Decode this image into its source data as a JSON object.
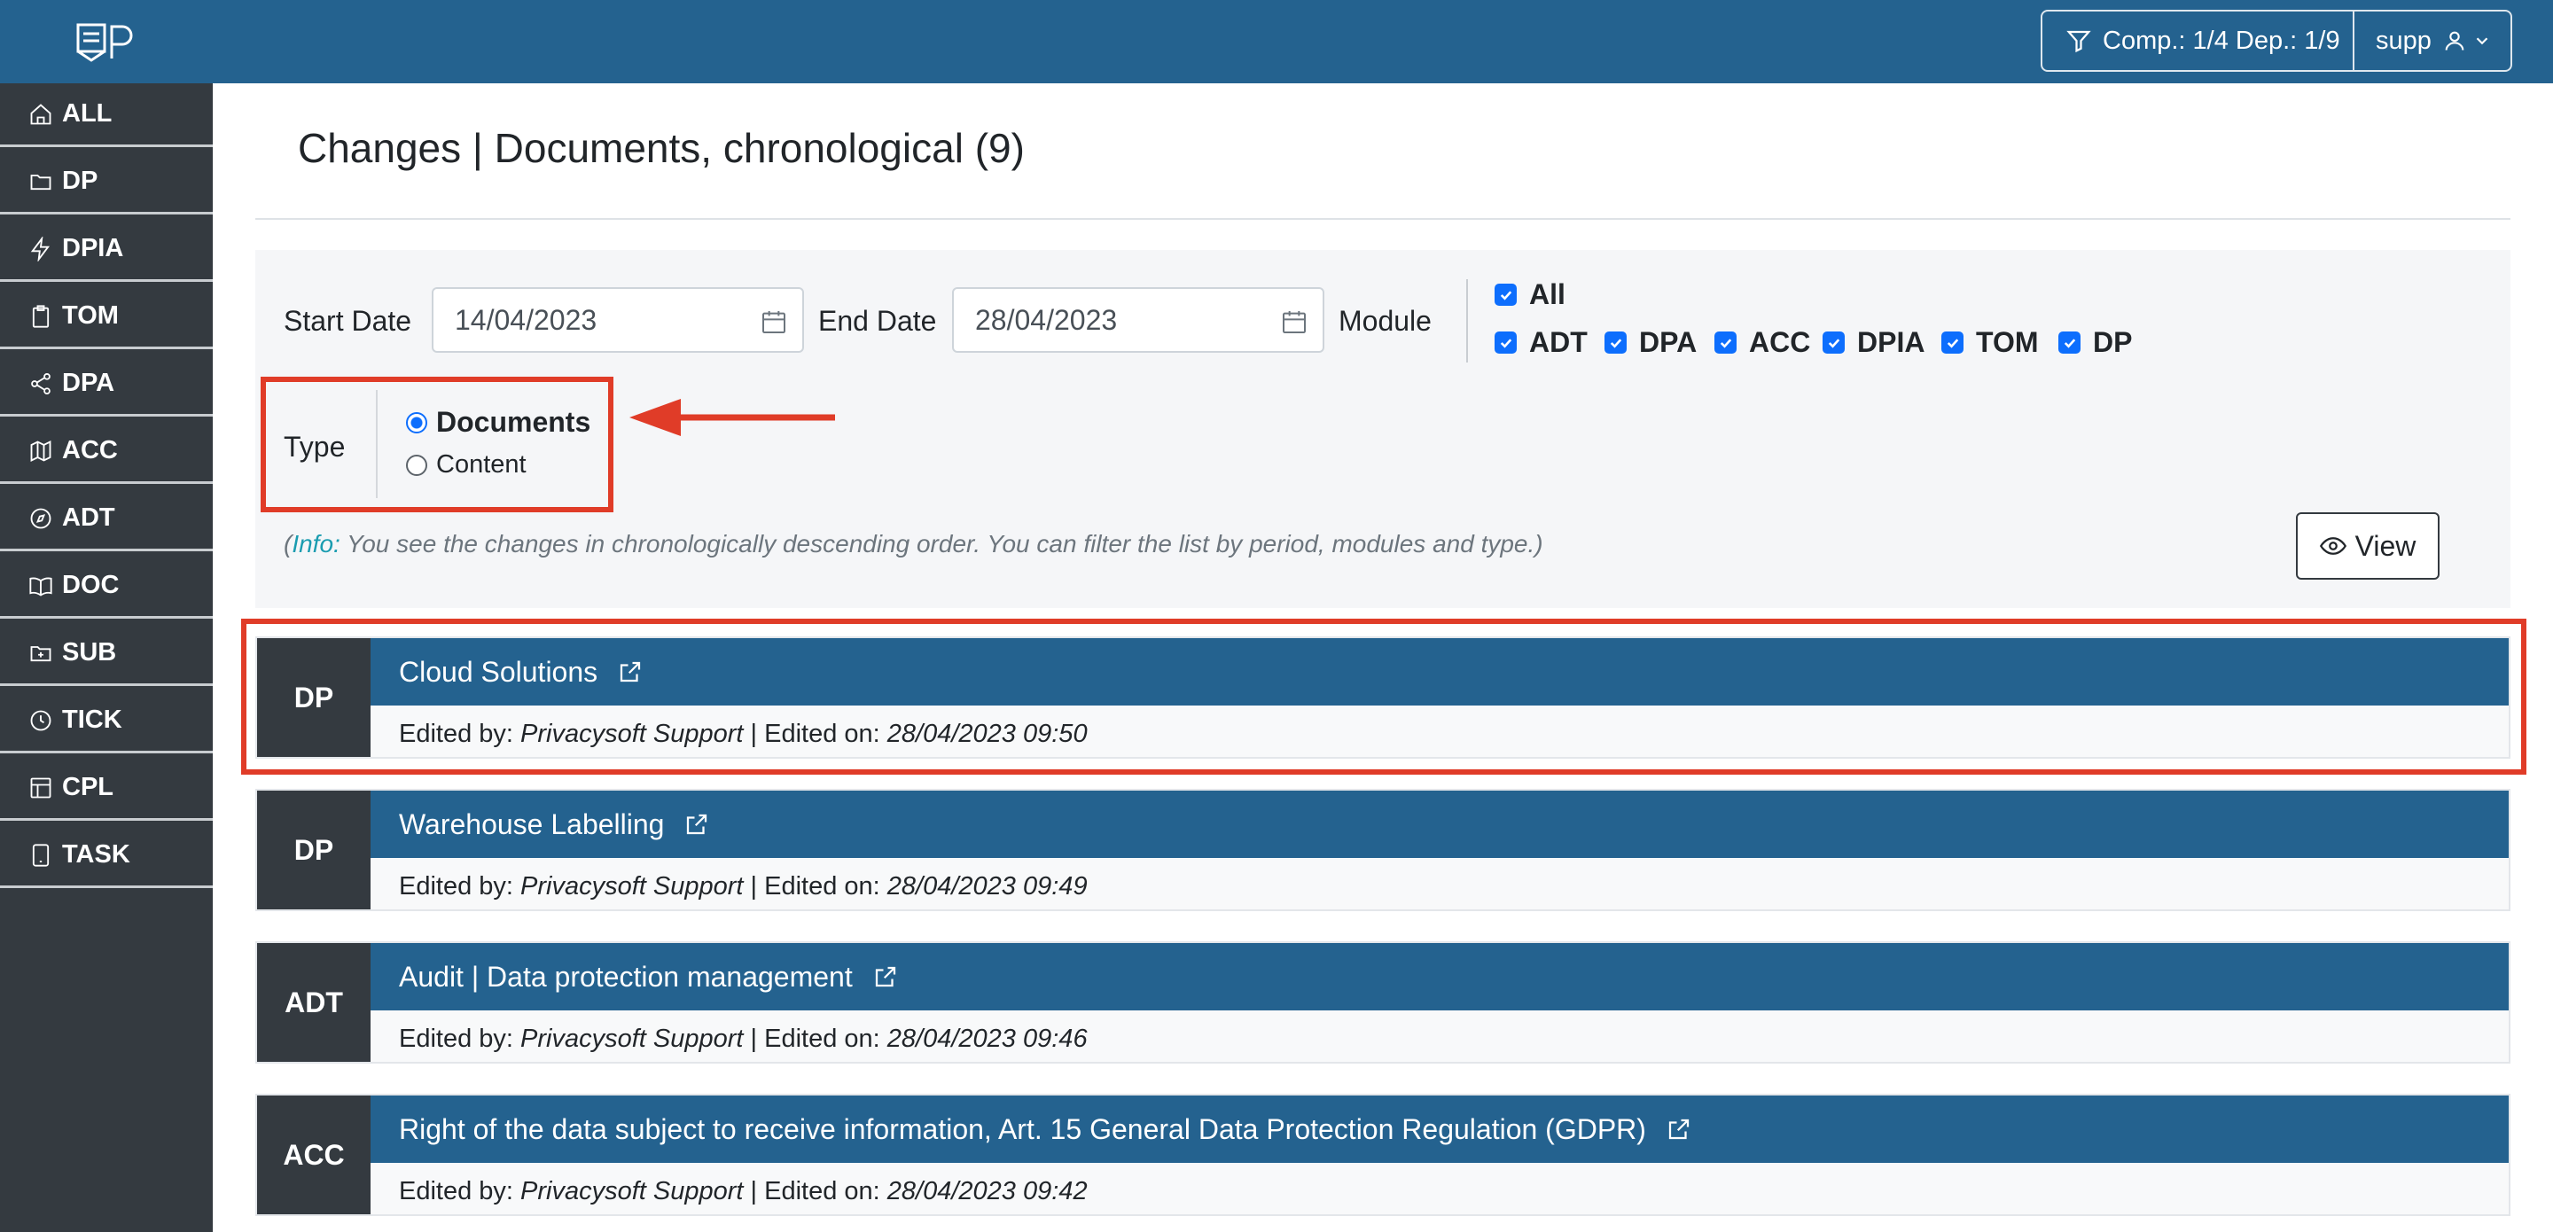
{
  "header": {
    "logo_icon": "document-logo-icon",
    "filter_label": "Comp.: 1/4 Dep.: 1/9",
    "user_label": "supp",
    "background": "#24628f"
  },
  "sidebar": {
    "items": [
      {
        "label": "ALL",
        "icon": "home-icon"
      },
      {
        "label": "DP",
        "icon": "folder-icon"
      },
      {
        "label": "DPIA",
        "icon": "lightning-icon"
      },
      {
        "label": "TOM",
        "icon": "clipboard-icon"
      },
      {
        "label": "DPA",
        "icon": "share-icon"
      },
      {
        "label": "ACC",
        "icon": "map-icon"
      },
      {
        "label": "ADT",
        "icon": "compass-icon"
      },
      {
        "label": "DOC",
        "icon": "book-icon"
      },
      {
        "label": "SUB",
        "icon": "folder-plus-icon"
      },
      {
        "label": "TICK",
        "icon": "clock-icon"
      },
      {
        "label": "CPL",
        "icon": "layout-icon"
      },
      {
        "label": "TASK",
        "icon": "tablet-icon"
      }
    ]
  },
  "page": {
    "title": "Changes | Documents, chronological (9)"
  },
  "filters": {
    "start_date_label": "Start Date",
    "start_date_value": "14/04/2023",
    "end_date_label": "End Date",
    "end_date_value": "28/04/2023",
    "module_label": "Module",
    "modules": [
      {
        "label": "All",
        "checked": true
      },
      {
        "label": "ADT",
        "checked": true
      },
      {
        "label": "DPA",
        "checked": true
      },
      {
        "label": "ACC",
        "checked": true
      },
      {
        "label": "DPIA",
        "checked": true
      },
      {
        "label": "TOM",
        "checked": true
      },
      {
        "label": "DP",
        "checked": true
      }
    ],
    "type_label": "Type",
    "type_options": [
      {
        "label": "Documents",
        "selected": true
      },
      {
        "label": "Content",
        "selected": false
      }
    ],
    "info_prefix": "(",
    "info_highlight": "Info:",
    "info_text": " You see the changes in chronologically descending order. You can filter the list by period, modules and type.)",
    "view_label": "View"
  },
  "changes": [
    {
      "module": "DP",
      "title": "Cloud Solutions",
      "edited_by_label": "Edited by: ",
      "editor": "Privacysoft Support",
      "edited_on_label": " | Edited on: ",
      "timestamp": "28/04/2023 09:50"
    },
    {
      "module": "DP",
      "title": "Warehouse Labelling",
      "edited_by_label": "Edited by: ",
      "editor": "Privacysoft Support",
      "edited_on_label": " | Edited on: ",
      "timestamp": "28/04/2023 09:49"
    },
    {
      "module": "ADT",
      "title": "Audit | Data protection management",
      "edited_by_label": "Edited by: ",
      "editor": "Privacysoft Support",
      "edited_on_label": " | Edited on: ",
      "timestamp": "28/04/2023 09:46"
    },
    {
      "module": "ACC",
      "title": "Right of the data subject to receive information, Art. 15 General Data Protection Regulation (GDPR)",
      "edited_by_label": "Edited by: ",
      "editor": "Privacysoft Support",
      "edited_on_label": " | Edited on: ",
      "timestamp": "28/04/2023 09:42"
    }
  ],
  "colors": {
    "primary": "#24628f",
    "sidebar": "#343a40",
    "annotation": "#e03c28",
    "checkbox": "#0d6efd",
    "info": "#1a9cb0"
  }
}
